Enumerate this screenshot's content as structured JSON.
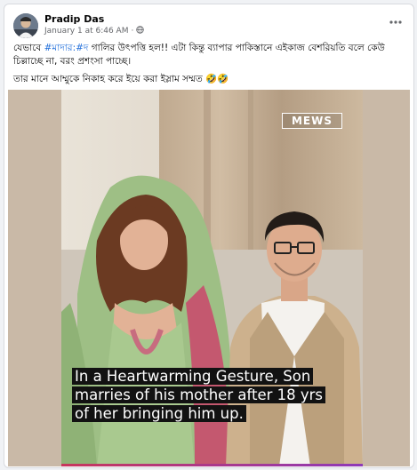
{
  "post": {
    "author": "Pradip Das",
    "date": "January 1 at 6:46 AM",
    "separator": "·",
    "audience_icon": "globe-icon",
    "more_icon": "more-options-icon",
    "text_line1_before": "যেভাবে ",
    "text_hashtag": "#মাদার:#দ",
    "text_line1_after": " গালির উৎপত্তি হল!! এটা কিন্তু ব্যাপার পাকিস্তানে এইকাজ বেশরিয়তি বলে কেউ চিল্লাচ্ছে না, বরং প্রশংসা পাচ্ছে।",
    "text_line2": "তার মানে আম্মুকে নিকাহ করে ইয়ে করা ইস্লাম সম্মত 🤣🤣"
  },
  "video": {
    "watermark": "MEWS",
    "caption_line1": "In a Heartwarming Gesture, Son",
    "caption_line2": "marries of his mother after 18 yrs",
    "caption_line3": "of her bringing him up."
  },
  "colors": {
    "hashtag": "#216fdb",
    "card_bg": "#ffffff",
    "page_bg": "#f0f2f5",
    "media_bg": "#c9b9a7",
    "progress_start": "#c7375c",
    "progress_end": "#8e3ab8"
  }
}
